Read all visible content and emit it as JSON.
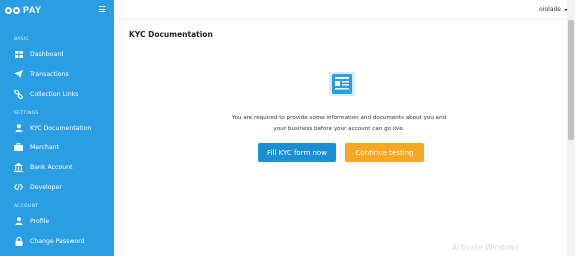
{
  "brand": {
    "name": "PAY"
  },
  "sidebar": {
    "sections": [
      {
        "label": "BASIC",
        "items": [
          {
            "label": "Dashboard",
            "icon": "dashboard-icon"
          },
          {
            "label": "Transactions",
            "icon": "paper-plane-icon"
          },
          {
            "label": "Collection Links",
            "icon": "link-icon"
          }
        ]
      },
      {
        "label": "SETTINGS",
        "items": [
          {
            "label": "KYC Documentation",
            "icon": "user-icon"
          },
          {
            "label": "Merchant",
            "icon": "briefcase-icon"
          },
          {
            "label": "Bank Account",
            "icon": "bank-icon"
          },
          {
            "label": "Developer",
            "icon": "code-icon"
          }
        ]
      },
      {
        "label": "ACCOUNT",
        "items": [
          {
            "label": "Profile",
            "icon": "user-icon"
          },
          {
            "label": "Change Password",
            "icon": "lock-icon"
          }
        ]
      }
    ]
  },
  "topbar": {
    "user": "oiolade"
  },
  "main": {
    "title": "KYC Documentation",
    "message_line1": "You are required to provide some information and documents about you and",
    "message_line2": "your business before your account can go live.",
    "primary_button": "Fill KYC form now",
    "secondary_button": "Continue testing"
  },
  "watermark": "Activate Windows",
  "colors": {
    "sidebar": "#2a9ee2",
    "primary": "#1a8fd4",
    "warning": "#f5a623"
  }
}
